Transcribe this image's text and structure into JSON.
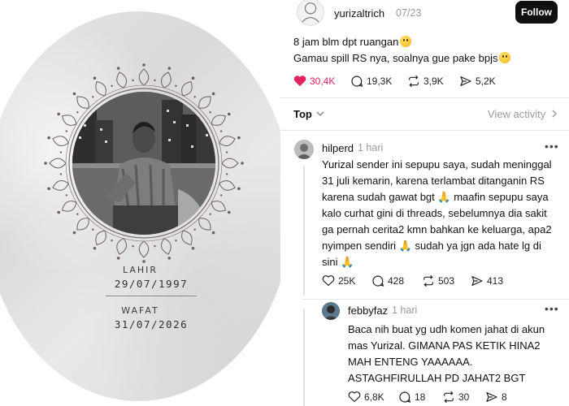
{
  "memorial": {
    "born_label": "LAHIR",
    "born_date": "29/07/1997",
    "died_label": "WAFAT",
    "died_date": "31/07/2026"
  },
  "post": {
    "username": "yurizaltrich",
    "time": "07/23",
    "follow_label": "Follow",
    "line1": "8 jam blm dpt ruangan",
    "line2": "Gamau spill RS nya, soalnya gue pake bpjs",
    "likes": "30,4K",
    "comments": "19,3K",
    "reposts": "3,9K",
    "shares": "5,2K",
    "like_color": "#e0245e"
  },
  "sort": {
    "label": "Top",
    "view_activity": "View activity"
  },
  "replies": [
    {
      "username": "hilperd",
      "time": "1 hari",
      "lines": [
        "Yurizal sender ini sepupu saya, sudah meninggal",
        "31 juli kemarin, karena terlambat ditanganin RS",
        "karena sudah gawat bgt",
        "kalo curhat gini di threads, sebelumnya dia sakit",
        "ga pernah cerita2 kmn bahkan ke keluarga, apa2",
        "nyimpen sendiri",
        "sini"
      ],
      "line3_tail": "maafin sepupu saya",
      "line6_tail": "sudah ya jgn ada hate lg di",
      "likes": "25K",
      "comments": "428",
      "reposts": "503",
      "shares": "413"
    },
    {
      "username": "febbyfaz",
      "time": "1 hari",
      "lines": [
        "Baca nih buat yg udh komen jahat di akun",
        "mas Yurizal. GIMANA PAS KETIK HINA2",
        "MAH ENTENG YAAAAAA.",
        "ASTAGHFIRULLAH PD JAHAT2 BGT"
      ],
      "likes": "6,8K",
      "comments": "18",
      "reposts": "30",
      "shares": "8"
    }
  ]
}
